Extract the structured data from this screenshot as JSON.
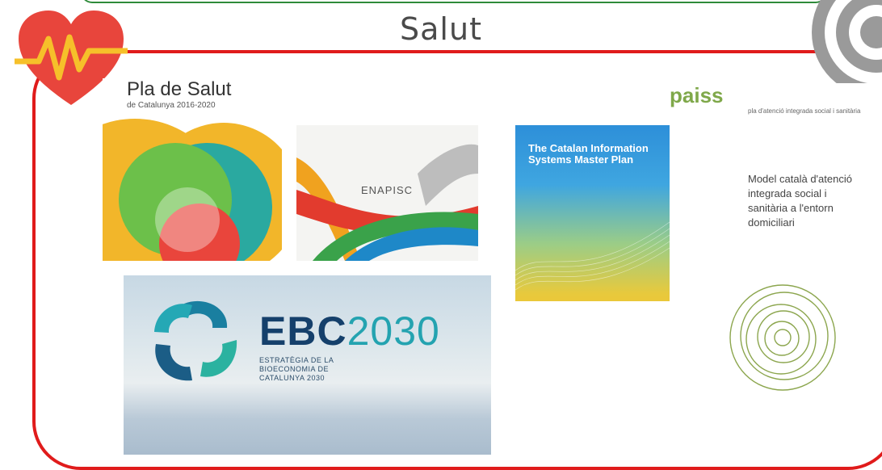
{
  "page": {
    "title": "Salut"
  },
  "cards": {
    "pla_salut": {
      "title": "Pla de Salut",
      "subtitle": "de Catalunya 2016-2020"
    },
    "enapisc": {
      "title": "ENAPISC"
    },
    "catalan_is": {
      "title": "The Catalan Information Systems Master Plan"
    },
    "paiss": {
      "logo": "paiss",
      "subtitle": "pla d'atenció integrada social i sanitària",
      "main": "Model català d'atenció integrada social i sanitària a l'entorn domiciliari"
    },
    "ebc2030": {
      "logo_main": "EBC",
      "logo_year": "2030",
      "subtitle": "ESTRATÈGIA DE LA BIOECONOMIA DE CATALUNYA 2030"
    }
  },
  "colors": {
    "frame": "#e01b1b",
    "top_border": "#2e8b3a",
    "heart": "#e8453c"
  },
  "icons": [
    "heart-pulse-icon",
    "target-icon"
  ]
}
